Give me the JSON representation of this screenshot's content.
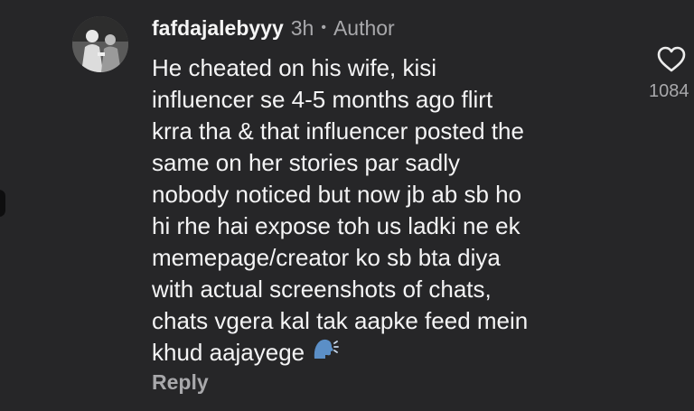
{
  "comment": {
    "username": "fafdajalebyyy",
    "time": "3h",
    "separator": "•",
    "role": "Author",
    "lines": [
      "He cheated on his wife, kisi",
      "influencer se 4-5 months ago flirt",
      "krra tha & that influencer posted the",
      "same on her stories par sadly",
      "nobody noticed but now jb ab sb ho",
      "hi rhe hai expose toh us ladki ne ek",
      "memepage/creator ko sb bta diya",
      "with actual screenshots of chats,",
      "chats vgera kal tak aapke feed mein",
      "khud aajayege"
    ],
    "emoji_icon": "speaking-head-icon",
    "reply_label": "Reply",
    "like_count": "1084"
  },
  "colors": {
    "background": "#262628",
    "text": "#f4f4f5",
    "muted": "#a8a8ab",
    "emoji_blue": "#5b8fc7"
  },
  "icons": {
    "avatar": "avatar-photo",
    "like": "heart-outline-icon"
  }
}
